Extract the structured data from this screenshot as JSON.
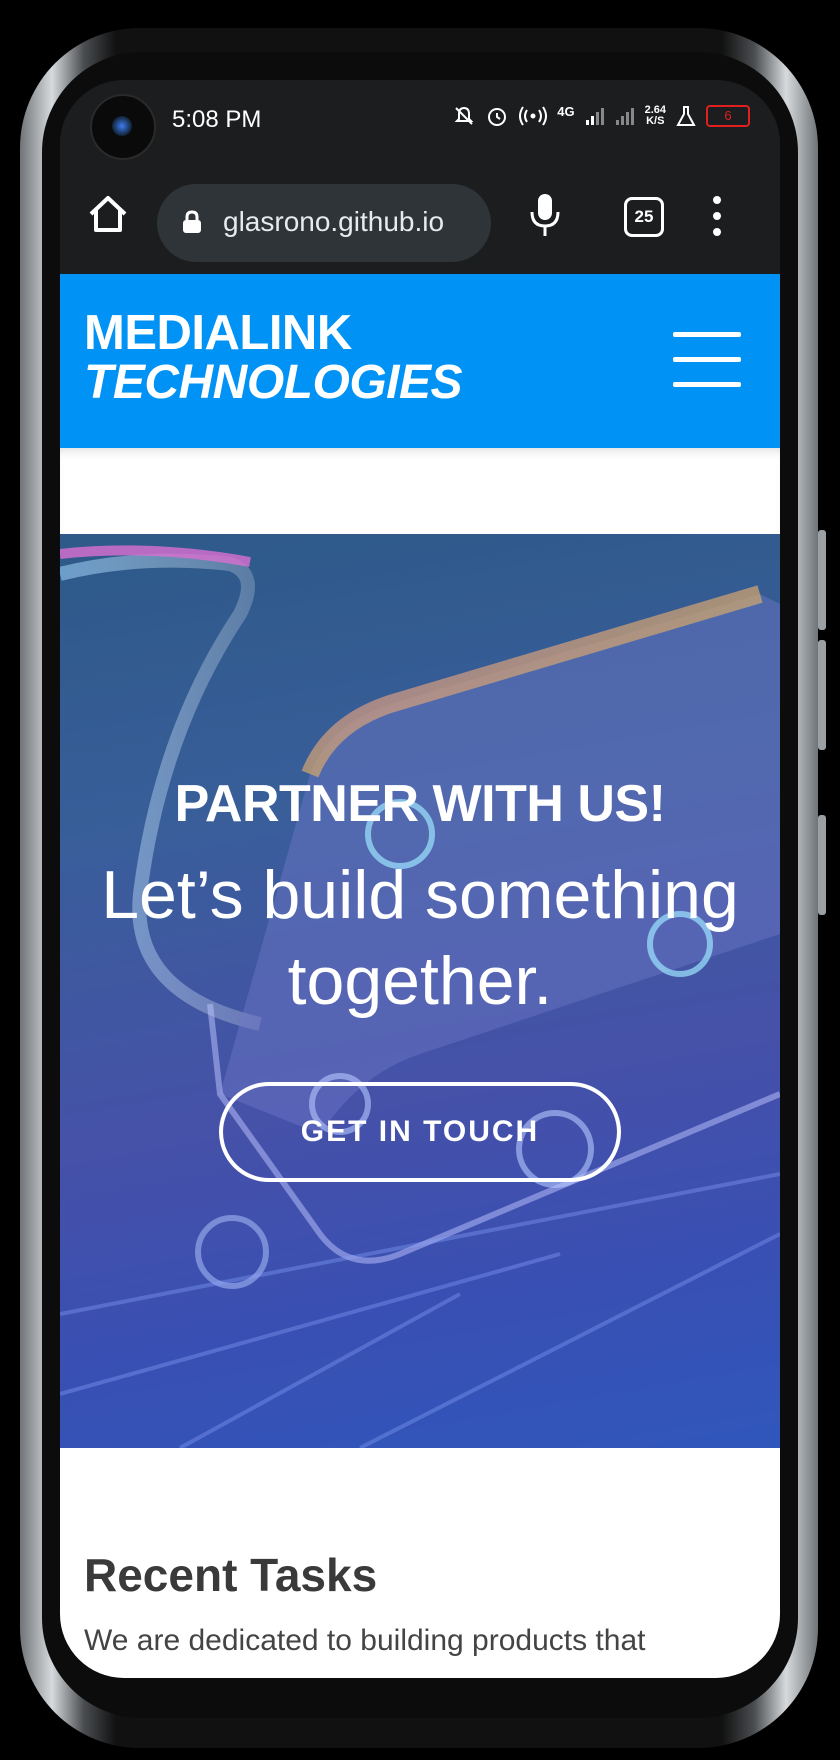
{
  "statusbar": {
    "time": "5:08 PM",
    "network": "4G",
    "speed_value": "2.64",
    "speed_unit": "K/S",
    "battery": "6"
  },
  "browser": {
    "url": "glasrono.github.io",
    "tab_count": "25"
  },
  "navbar": {
    "brand_line1": "MEDIALINK",
    "brand_line2": "TECHNOLOGIES",
    "brand_color": "#0192f5"
  },
  "hero": {
    "title": "PARTNER WITH US!",
    "subtitle_line1": "Let’s build something",
    "subtitle_line2": "together.",
    "cta_label": "GET IN TOUCH"
  },
  "recent": {
    "title": "Recent Tasks",
    "text": "We are dedicated to building products that"
  }
}
